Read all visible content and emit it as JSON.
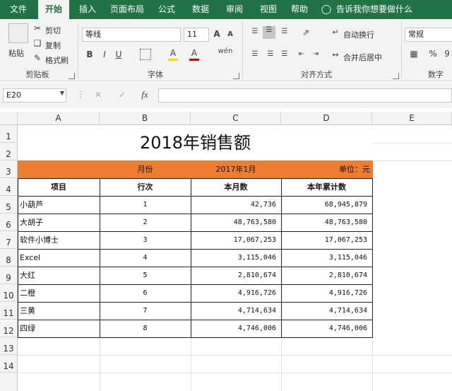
{
  "tabs": [
    "文件",
    "开始",
    "插入",
    "页面布局",
    "公式",
    "数据",
    "审阅",
    "视图",
    "帮助"
  ],
  "tell_me": "告诉我你想要做什么",
  "clipboard": {
    "paste": "粘贴",
    "cut": "剪切",
    "copy": "复制",
    "format_painter": "格式刷",
    "group": "剪贴板"
  },
  "font": {
    "name": "等线",
    "size": "11",
    "bold": "B",
    "italic": "I",
    "underline": "U",
    "grow": "A",
    "shrink": "A",
    "phonetic": "wén",
    "font_color_letter": "A",
    "highlight_letter": "A",
    "group": "字体"
  },
  "alignment": {
    "wrap": "自动换行",
    "merge": "合并后居中",
    "group": "对齐方式"
  },
  "number": {
    "format": "常规",
    "percent": "%",
    "comma": "9",
    "group": "数字"
  },
  "formula_bar": {
    "name_box": "E20",
    "fx": "fx",
    "formula": ""
  },
  "columns": [
    "A",
    "B",
    "C",
    "D",
    "E"
  ],
  "rows": [
    "1",
    "2",
    "3",
    "4",
    "5",
    "6",
    "7",
    "8",
    "9",
    "10",
    "11",
    "12",
    "13",
    "14"
  ],
  "sheet": {
    "title": "2018年销售额",
    "month_label": "月份",
    "month_value": "2017年1月",
    "unit_label": "单位：元",
    "headers": [
      "项目",
      "行次",
      "本月数",
      "本年累计数"
    ],
    "rows": [
      {
        "item": "小葫芦",
        "no": "1",
        "month": "42,736",
        "ytd": "68,945,879"
      },
      {
        "item": "大胡子",
        "no": "2",
        "month": "48,763,580",
        "ytd": "48,763,580"
      },
      {
        "item": "软件小博士",
        "no": "3",
        "month": "17,067,253",
        "ytd": "17,067,253"
      },
      {
        "item": "Excel",
        "no": "4",
        "month": "3,115,046",
        "ytd": "3,115,046"
      },
      {
        "item": "大红",
        "no": "5",
        "month": "2,810,674",
        "ytd": "2,810,674"
      },
      {
        "item": "二橙",
        "no": "6",
        "month": "4,916,726",
        "ytd": "4,916,726"
      },
      {
        "item": "三黄",
        "no": "7",
        "month": "4,714,634",
        "ytd": "4,714,634"
      },
      {
        "item": "四绿",
        "no": "8",
        "month": "4,746,006",
        "ytd": "4,746,006"
      }
    ]
  },
  "colors": {
    "ribbon_green": "#217346",
    "band_orange": "#ed7d31",
    "font_red": "#e00000",
    "fill_yellow": "#ffd700"
  }
}
